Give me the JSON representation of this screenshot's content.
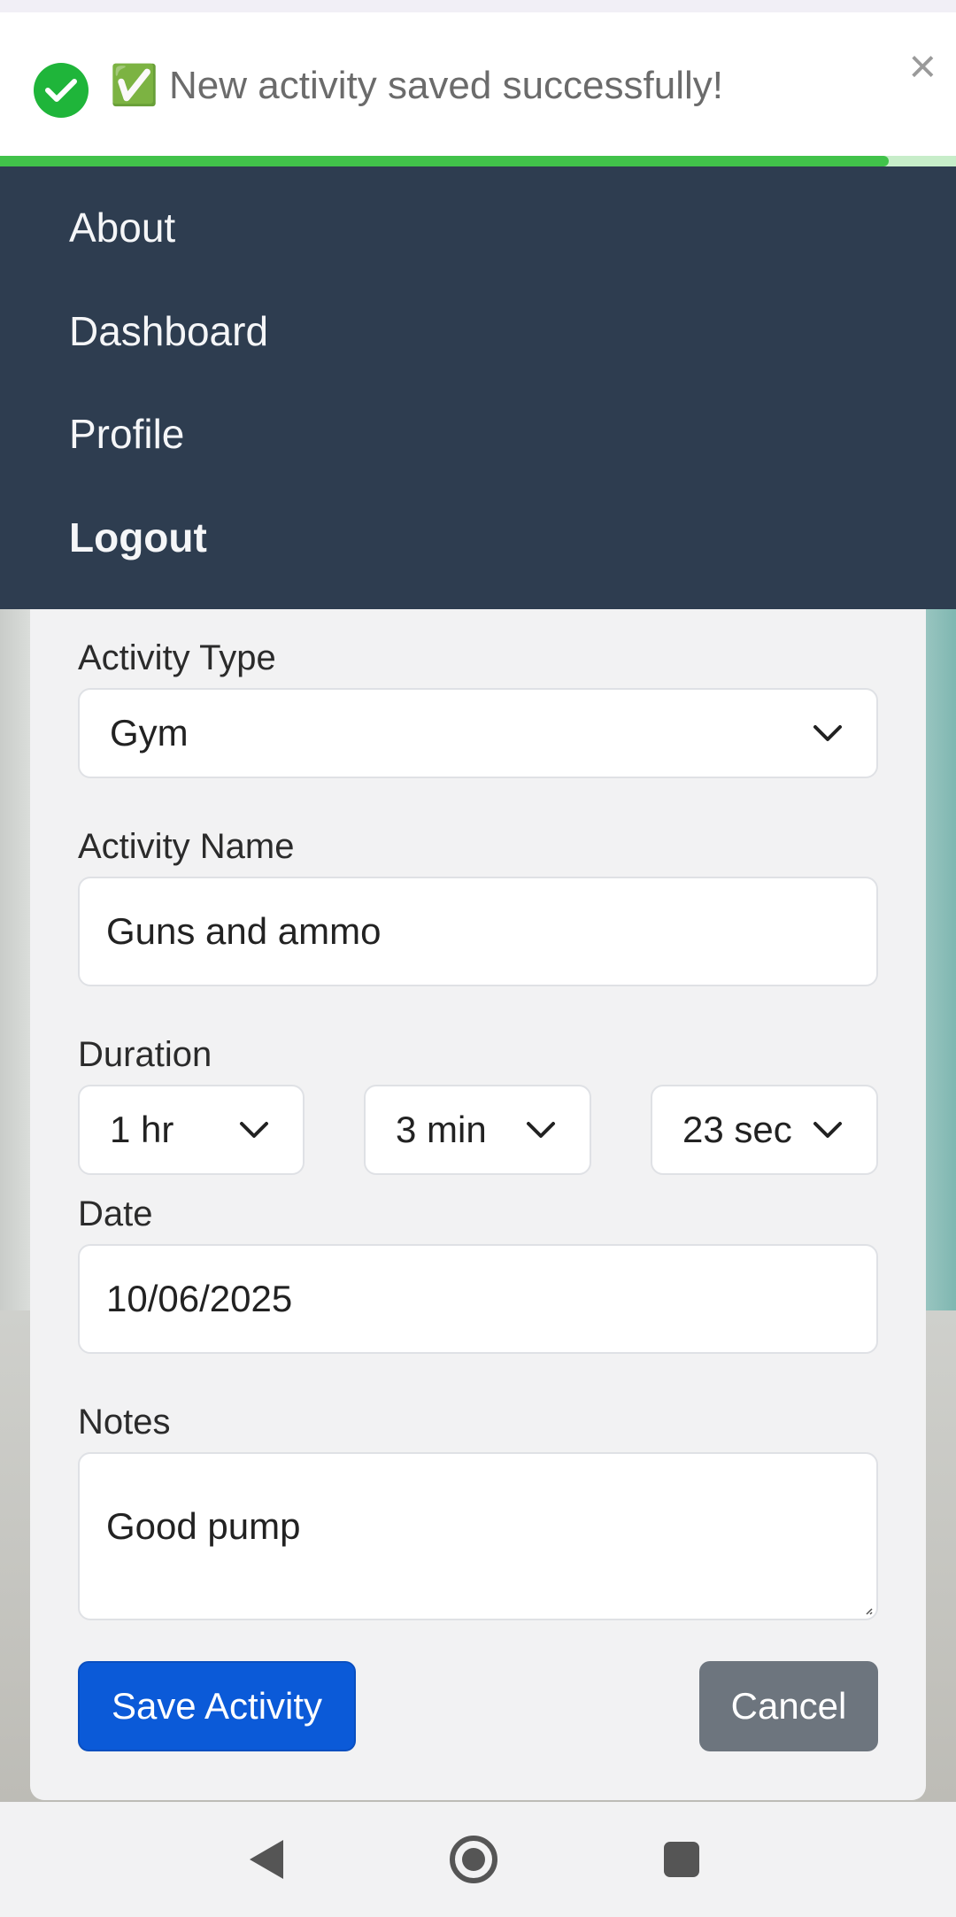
{
  "toast": {
    "message": "✅ New activity saved successfully!",
    "close": "×",
    "progress": 0.93,
    "color": "#1fb53a"
  },
  "nav": {
    "items": [
      "About",
      "Dashboard",
      "Profile",
      "Logout"
    ],
    "background": "#2e3d50"
  },
  "form": {
    "activity_type": {
      "label": "Activity Type",
      "value": "Gym"
    },
    "activity_name": {
      "label": "Activity Name",
      "value": "Guns and ammo"
    },
    "duration": {
      "label": "Duration",
      "hours": "1 hr",
      "minutes": "3 min",
      "seconds": "23 sec"
    },
    "date": {
      "label": "Date",
      "value": "10/06/2025"
    },
    "notes": {
      "label": "Notes",
      "value": "Good pump"
    },
    "save_label": "Save Activity",
    "cancel_label": "Cancel",
    "primary_color": "#0b5ad8",
    "secondary_color": "#6d757e"
  },
  "system_nav": {
    "icons": [
      "back-icon",
      "home-icon",
      "recents-icon"
    ]
  }
}
